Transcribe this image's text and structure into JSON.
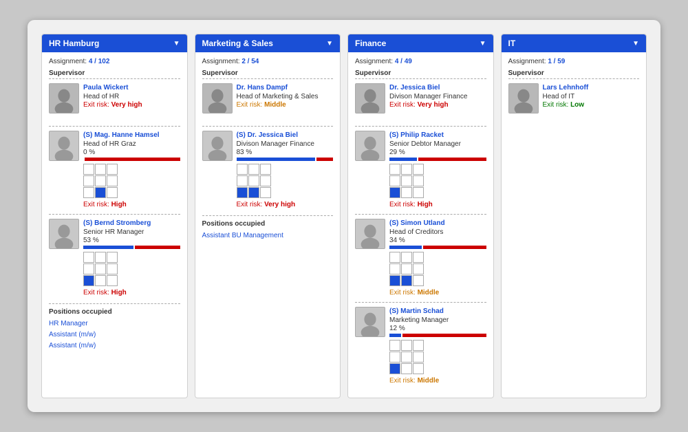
{
  "columns": [
    {
      "id": "hr-hamburg",
      "title": "HR Hamburg",
      "assignment": "4 / 102",
      "supervisor": {
        "name": "Paula Wickert",
        "role": "Head of HR",
        "exit_risk": "Very high",
        "exit_risk_class": "exit-risk-veryhigh",
        "avatar_letter": "👩"
      },
      "successors": [
        {
          "name": "(S) Mag. Hanne Hamsel",
          "role": "Head of HR Graz",
          "progress_label": "0 %",
          "progress_value": 0,
          "grid_filled": [
            7
          ],
          "exit_risk": "High",
          "exit_risk_class": "exit-risk-high"
        },
        {
          "name": "(S) Bernd Stromberg",
          "role": "Senior HR Manager",
          "progress_label": "53 %",
          "progress_value": 53,
          "grid_filled": [
            6
          ],
          "exit_risk": "High",
          "exit_risk_class": "exit-risk-high"
        }
      ],
      "positions": [
        "HR Manager",
        "Assistant (m/w)",
        "Assistant (m/w)"
      ]
    },
    {
      "id": "marketing-sales",
      "title": "Marketing & Sales",
      "assignment": "2 / 54",
      "supervisor": {
        "name": "Dr. Hans Dampf",
        "role": "Head of Marketing & Sales",
        "exit_risk": "Middle",
        "exit_risk_class": "exit-risk-middle",
        "avatar_letter": "👨"
      },
      "successors": [
        {
          "name": "(S) Dr. Jessica Biel",
          "role": "Divison Manager Finance",
          "progress_label": "83 %",
          "progress_value": 83,
          "grid_filled": [
            6,
            7
          ],
          "exit_risk": "Very high",
          "exit_risk_class": "exit-risk-veryhigh"
        }
      ],
      "positions": [
        "Assistant BU Management"
      ]
    },
    {
      "id": "finance",
      "title": "Finance",
      "assignment": "4 / 49",
      "supervisor": {
        "name": "Dr. Jessica Biel",
        "role": "Divison Manager Finance",
        "exit_risk": "Very high",
        "exit_risk_class": "exit-risk-veryhigh",
        "avatar_letter": "👩"
      },
      "successors": [
        {
          "name": "(S) Philip Racket",
          "role": "Senior Debtor Manager",
          "progress_label": "29 %",
          "progress_value": 29,
          "grid_filled": [
            6
          ],
          "exit_risk": "High",
          "exit_risk_class": "exit-risk-high"
        },
        {
          "name": "(S) Simon Utland",
          "role": "Head of Creditors",
          "progress_label": "34 %",
          "progress_value": 34,
          "grid_filled": [
            6,
            7
          ],
          "exit_risk": "Middle",
          "exit_risk_class": "exit-risk-middle"
        },
        {
          "name": "(S) Martin Schad",
          "role": "Marketing Manager",
          "progress_label": "12 %",
          "progress_value": 12,
          "grid_filled": [
            6
          ],
          "exit_risk": "Middle",
          "exit_risk_class": "exit-risk-middle"
        }
      ],
      "positions": []
    },
    {
      "id": "it",
      "title": "IT",
      "assignment": "1 / 59",
      "supervisor": {
        "name": "Lars Lehnhoff",
        "role": "Head of IT",
        "exit_risk": "Low",
        "exit_risk_class": "exit-risk-low",
        "avatar_letter": "👨"
      },
      "successors": [],
      "positions": []
    }
  ],
  "labels": {
    "assignment_prefix": "Assignment:",
    "supervisor": "Supervisor",
    "exit_risk_prefix": "Exit risk:",
    "positions_occupied": "Positions occupied",
    "dropdown_arrow": "▼"
  }
}
